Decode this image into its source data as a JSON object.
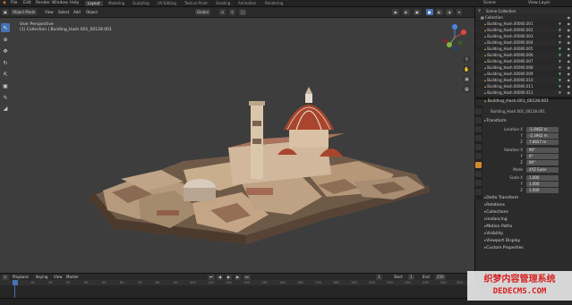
{
  "top_menu": {
    "items": [
      "File",
      "Edit",
      "Render",
      "Window",
      "Help"
    ],
    "workspace_tabs": [
      "Layout",
      "Modeling",
      "Sculpting",
      "UV Editing",
      "Texture Paint",
      "Shading",
      "Animation",
      "Rendering"
    ],
    "scene_label": "Scene",
    "layer_label": "View Layer"
  },
  "viewport_header": {
    "mode": "Object Mode",
    "menus": [
      "View",
      "Select",
      "Add",
      "Object"
    ],
    "transform": "Global"
  },
  "viewport_info": {
    "line1": "User Perspective",
    "line2": "(1) Collection | Building_Hash.001_00128.001"
  },
  "outliner": {
    "title": "Scene Collection",
    "collection": "Collection",
    "items": [
      "Building_Hash.00000.001",
      "Building_Hash.00000.002",
      "Building_Hash.00000.003",
      "Building_Hash.00000.004",
      "Building_Hash.00000.005",
      "Building_Hash.00000.006",
      "Building_Hash.00000.007",
      "Building_Hash.00000.008",
      "Building_Hash.00000.009",
      "Building_Hash.00000.010",
      "Building_Hash.00000.011",
      "Building_Hash.00000.012"
    ]
  },
  "properties": {
    "object_name": "Building_Hash.001_00128.001",
    "breadcrumb": "Building_Hash.001_00128.001",
    "transform_title": "Transform",
    "location": {
      "label": "Location X",
      "x": "-1.9462 m",
      "y": "-2.3962 m",
      "z": "7.8657 m"
    },
    "rotation": {
      "label": "Rotation X",
      "x": "90°",
      "y": "0°",
      "z": "90°"
    },
    "mode": {
      "label": "Mode",
      "value": "XYZ Euler"
    },
    "scale": {
      "label": "Scale X",
      "x": "1.000",
      "y": "1.000",
      "z": "1.000"
    },
    "axis_y": "Y",
    "axis_z": "Z",
    "sections": [
      "Delta Transform",
      "Relations",
      "Collections",
      "Instancing",
      "Motion Paths",
      "Visibility",
      "Viewport Display",
      "Custom Properties"
    ]
  },
  "timeline": {
    "menus": [
      "Playback",
      "Keying",
      "View",
      "Marker"
    ],
    "ticks": [
      "0",
      "10",
      "20",
      "30",
      "40",
      "50",
      "60",
      "70",
      "80",
      "90",
      "100",
      "110",
      "120",
      "130",
      "140",
      "150",
      "160",
      "170",
      "180",
      "190",
      "200",
      "210",
      "220",
      "230",
      "240",
      "250"
    ],
    "current_frame": "1",
    "start_label": "Start",
    "start": "1",
    "end_label": "End",
    "end": "250"
  },
  "watermark": {
    "line1": "织梦内容管理系统",
    "line2": "DEDECMS.COM"
  },
  "colors": {
    "accent": "#4772b3",
    "viewport_bg": "#3d3d3d",
    "properties_active_tab": "#d08a2c"
  }
}
